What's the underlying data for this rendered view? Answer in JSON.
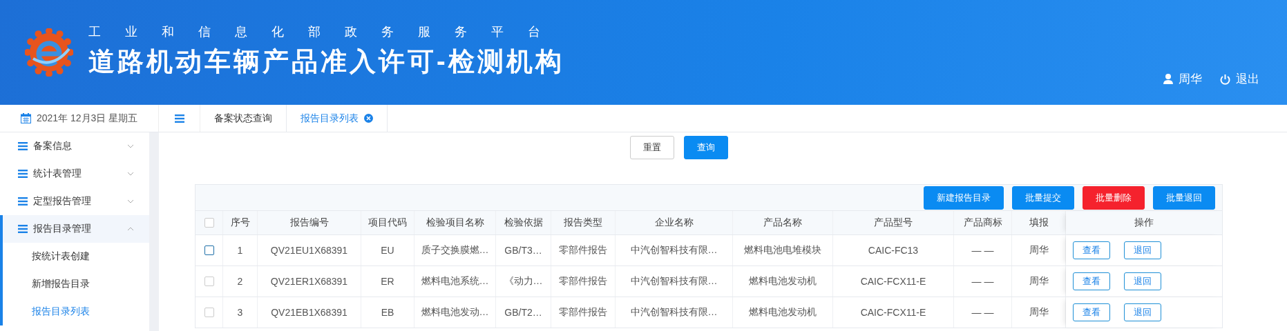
{
  "header": {
    "subtitle": "工业和信息化部政务服务平台",
    "title": "道路机动车辆产品准入许可-检测机构",
    "user": "周华",
    "logout": "退出"
  },
  "date": "2021年 12月3日 星期五",
  "tabs": [
    {
      "label": "备案状态查询",
      "selected": false,
      "closable": false
    },
    {
      "label": "报告目录列表",
      "selected": true,
      "closable": true
    }
  ],
  "sidebar": {
    "items": [
      {
        "label": "备案信息",
        "expanded": false
      },
      {
        "label": "统计表管理",
        "expanded": false
      },
      {
        "label": "定型报告管理",
        "expanded": false
      },
      {
        "label": "报告目录管理",
        "expanded": true,
        "children": [
          {
            "label": "按统计表创建",
            "selected": false
          },
          {
            "label": "新增报告目录",
            "selected": false
          },
          {
            "label": "报告目录列表",
            "selected": true
          }
        ]
      }
    ]
  },
  "search_buttons": [
    {
      "label": "重置",
      "kind": "default"
    },
    {
      "label": "查询",
      "kind": "primary"
    }
  ],
  "toolbar": [
    {
      "label": "新建报告目录",
      "kind": "primary"
    },
    {
      "label": "批量提交",
      "kind": "primary"
    },
    {
      "label": "批量删除",
      "kind": "danger"
    },
    {
      "label": "批量退回",
      "kind": "primary"
    }
  ],
  "table": {
    "all_checked": false,
    "columns": [
      "序号",
      "报告编号",
      "项目代码",
      "检验项目名称",
      "检验依据",
      "报告类型",
      "企业名称",
      "产品名称",
      "产品型号",
      "产品商标",
      "填报",
      "操作"
    ],
    "rows": [
      {
        "checked": false,
        "focused": true,
        "cells": [
          "1",
          "QV21EU1X68391",
          "EU",
          "质子交换膜燃…",
          "GB/T3…",
          "零部件报告",
          "中汽创智科技有限…",
          "燃料电池电堆模块",
          "CAIC-FC13",
          "— —",
          "周华"
        ],
        "actions": [
          "查看",
          "退回"
        ]
      },
      {
        "checked": false,
        "focused": false,
        "cells": [
          "2",
          "QV21ER1X68391",
          "ER",
          "燃料电池系统…",
          "《动力…",
          "零部件报告",
          "中汽创智科技有限…",
          "燃料电池发动机",
          "CAIC-FCX11-E",
          "— —",
          "周华"
        ],
        "actions": [
          "查看",
          "退回"
        ]
      },
      {
        "checked": false,
        "focused": false,
        "cells": [
          "3",
          "QV21EB1X68391",
          "EB",
          "燃料电池发动…",
          "GB/T2…",
          "零部件报告",
          "中汽创智科技有限…",
          "燃料电池发动机",
          "CAIC-FCX11-E",
          "— —",
          "周华"
        ],
        "actions": [
          "查看",
          "退回"
        ]
      }
    ]
  }
}
